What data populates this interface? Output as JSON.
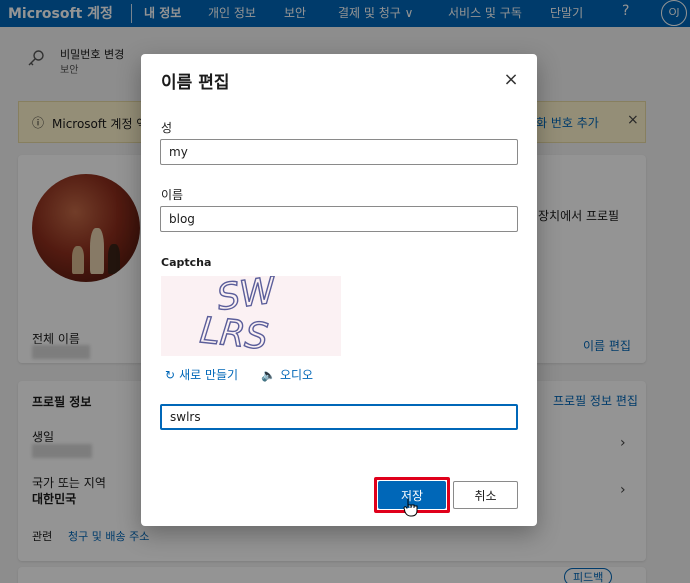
{
  "topnav": {
    "brand": "Microsoft 계정",
    "items": [
      "내 정보",
      "개인 정보",
      "보안",
      "결제 및 청구 ∨",
      "서비스 및 구독",
      "단말기"
    ],
    "help": "?",
    "avatar": "OJ"
  },
  "background": {
    "password_change": "비밀번호 변경",
    "password_sub": "보안",
    "notice_text": "Microsoft 계정 액",
    "notice_link": "화 번호 추가",
    "notice_close": "×",
    "device_profile_text": "장치에서 프로필",
    "full_name_label": "전체 이름",
    "edit_name_link": "이름 편집",
    "profile_info": "프로필 정보",
    "edit_profile_link": "프로필 정보 편집",
    "birthday_label": "생일",
    "country_label": "국가 또는 지역",
    "country_value": "대한민국",
    "related_label": "관련",
    "billing_link": "청구 및 배송 주소",
    "feedback": "피드백"
  },
  "dialog": {
    "title": "이름 편집",
    "close": "×",
    "surname_label": "성",
    "surname_value": "my",
    "name_label": "이름",
    "name_value": "blog",
    "captcha_label": "Captcha",
    "captcha_text": "SWLRS",
    "refresh_label": "새로 만들기",
    "audio_label": "오디오",
    "captcha_input_value": "swlrs",
    "save_label": "저장",
    "cancel_label": "취소"
  }
}
